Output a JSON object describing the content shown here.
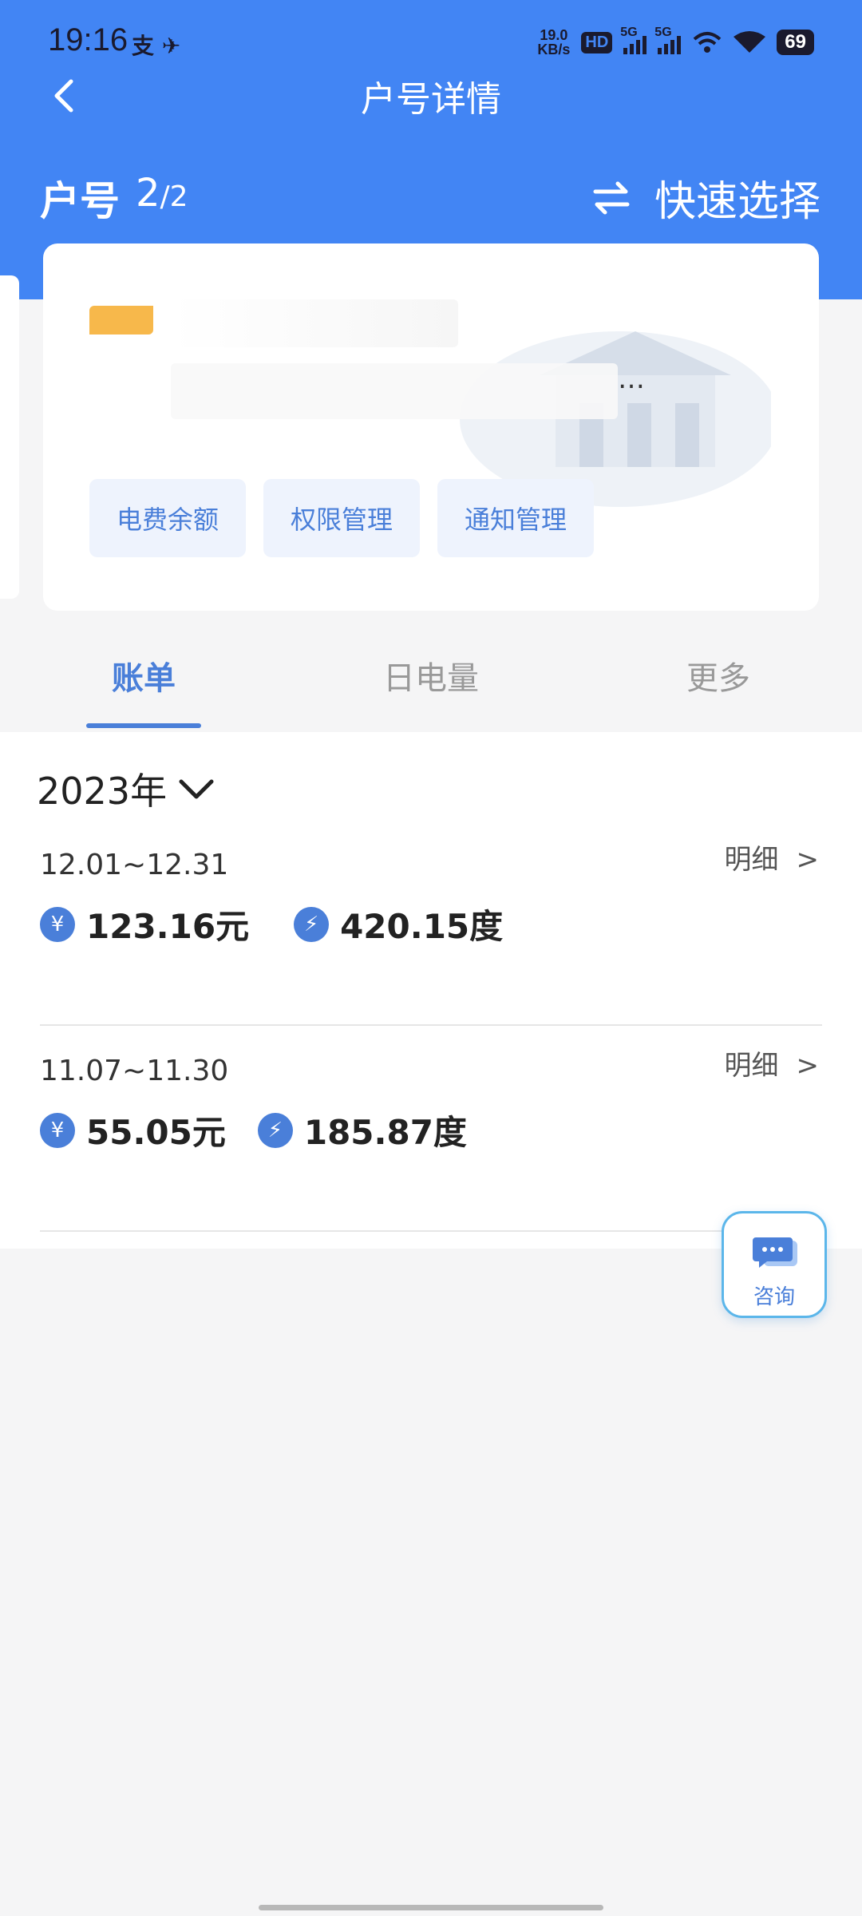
{
  "status_bar": {
    "time": "19:16",
    "app_icons": "支 ✈",
    "net_speed_value": "19.0",
    "net_speed_unit": "KB/s",
    "hd_label": "HD",
    "sim1_label": "5G",
    "sim2_label": "5G",
    "battery": "69"
  },
  "nav": {
    "title": "户号详情",
    "back_icon": "chevron-left-icon"
  },
  "account": {
    "label": "户号",
    "current": "2",
    "total": "/2",
    "quick_select_label": "快速选择",
    "quick_select_icon": "swap-arrows-icon"
  },
  "card": {
    "address_ellipsis": "…",
    "actions": [
      "电费余额",
      "权限管理",
      "通知管理"
    ]
  },
  "tabs": [
    "账单",
    "日电量",
    "更多"
  ],
  "active_tab": "账单",
  "bills": {
    "year": "2023年",
    "items": [
      {
        "period": "12.01~12.31",
        "detail_label": "明细",
        "detail_arrow": ">",
        "amount": "123.16元",
        "usage": "420.15度"
      },
      {
        "period": "11.07~11.30",
        "detail_label": "明细",
        "detail_arrow": ">",
        "amount": "55.05元",
        "usage": "185.87度"
      }
    ],
    "amount_icon_glyph": "¥",
    "usage_icon_glyph": "⚡"
  },
  "consult": {
    "label": "咨询",
    "icon": "chat-bubble-icon"
  },
  "colors": {
    "brand_blue": "#4285f4",
    "accent_blue": "#4a7fd9",
    "tag_orange": "#f7b84b"
  }
}
